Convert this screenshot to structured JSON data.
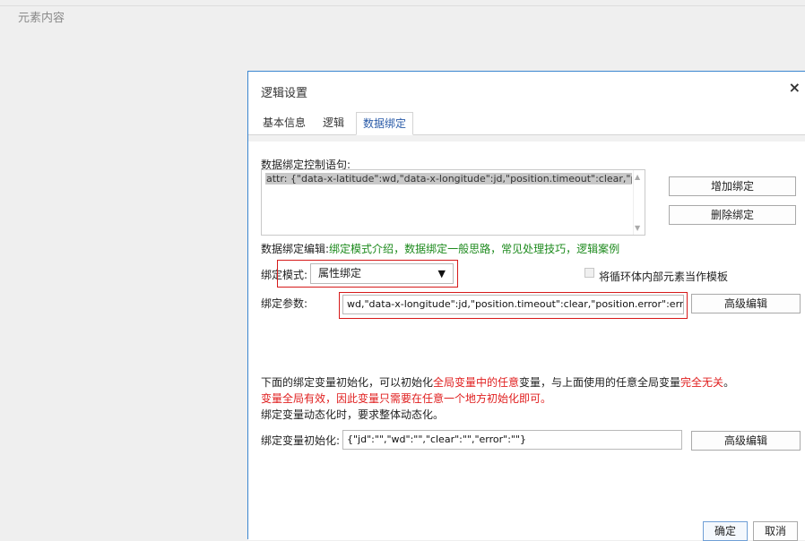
{
  "background": {
    "title": "元素内容"
  },
  "dialog": {
    "title": "逻辑设置",
    "close_icon": "×",
    "tabs": [
      {
        "label": "基本信息"
      },
      {
        "label": "逻辑"
      },
      {
        "label": "数据绑定",
        "active": true
      }
    ],
    "control_statement_label": "数据绑定控制语句:",
    "control_statement_value": "attr: {\"data-x-latitude\":wd,\"data-x-longitude\":jd,\"position.timeout\":clear,\"position.error\":error}",
    "add_binding_button": "增加绑定",
    "delete_binding_button": "删除绑定",
    "editor_prefix": "数据绑定编辑:",
    "editor_links": [
      "绑定模式介绍",
      "数据绑定一般思路",
      "常见处理技巧",
      "逻辑案例"
    ],
    "editor_separator": "，",
    "mode_label": "绑定模式:",
    "mode_value": "属性绑定",
    "loop_template_checkbox_label": "将循环体内部元素当作模板",
    "params_label": "绑定参数:",
    "params_value": "wd,\"data-x-longitude\":jd,\"position.timeout\":clear,\"position.error\":error}",
    "advanced_edit_button": "高级编辑",
    "note": {
      "line1_part1": "下面的绑定变量初始化，可以初始化",
      "line1_red1": "全局变量中的任意",
      "line1_part2": "变量，与上面使用的任意全局变量",
      "line1_red2": "完全无关",
      "line1_part3": "。",
      "line2": "变量全局有效，因此变量只需要在任意一个地方初始化即可。",
      "line3": "绑定变量动态化时，要求整体动态化。"
    },
    "init_label": "绑定变量初始化:",
    "init_value": "{\"jd\":\"\",\"wd\":\"\",\"clear\":\"\",\"error\":\"\"}",
    "init_advanced_button": "高级编辑",
    "ok_button": "确定",
    "cancel_button": "取消"
  },
  "colors": {
    "accent": "#3a86d0",
    "link": "#1d8a1d",
    "warning": "#e02020",
    "highlight_box": "#d61a1a"
  }
}
